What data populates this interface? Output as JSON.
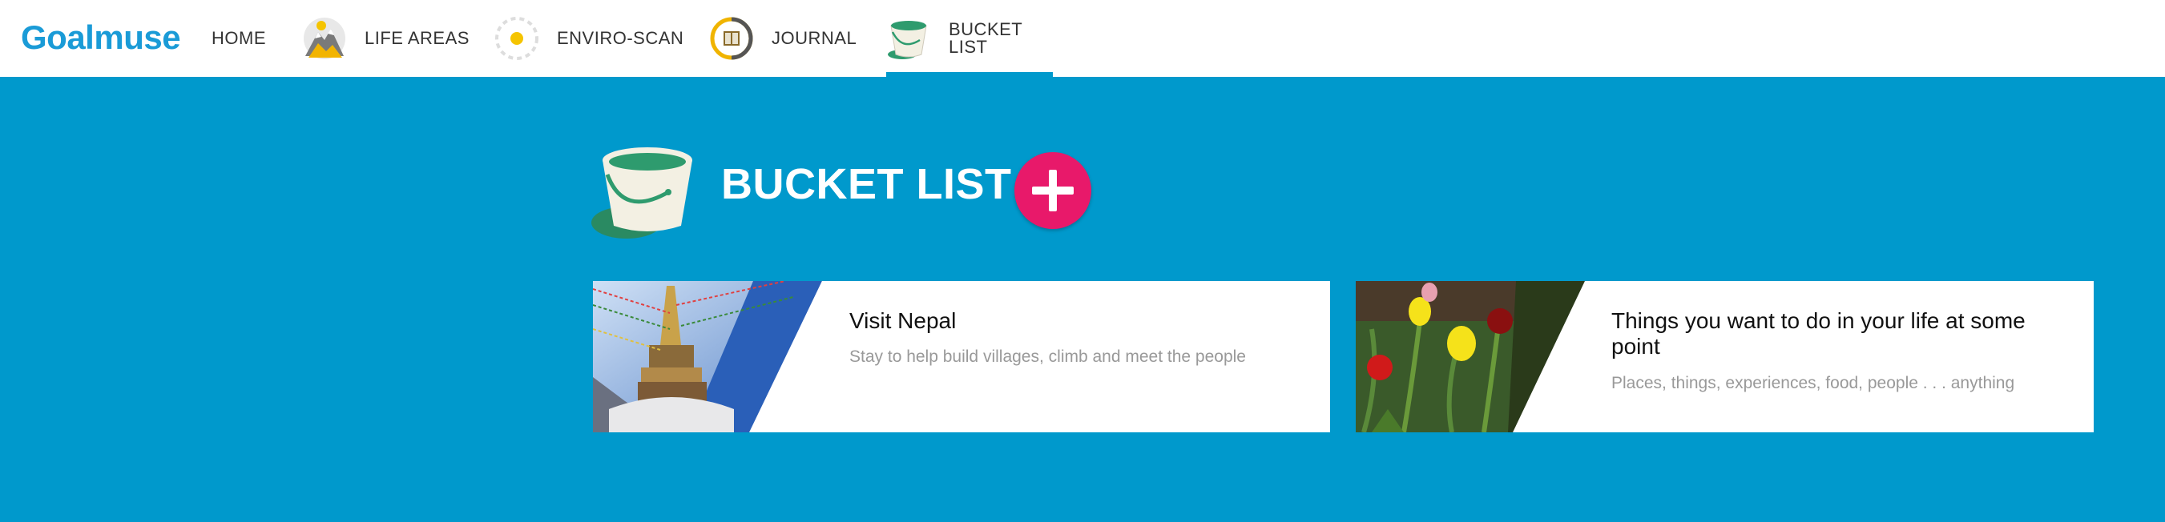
{
  "app": {
    "logo_text": "Goalmuse"
  },
  "nav": {
    "items": [
      {
        "label": "HOME",
        "icon": "none",
        "active": false
      },
      {
        "label": "LIFE AREAS",
        "icon": "mountain-icon",
        "active": false
      },
      {
        "label": "ENVIRO-SCAN",
        "icon": "sun-dotted-icon",
        "active": false
      },
      {
        "label": "JOURNAL",
        "icon": "journal-ring-icon",
        "active": false
      },
      {
        "label": "BUCKET LIST",
        "icon": "bucket-icon",
        "active": true
      }
    ]
  },
  "page": {
    "title": "BUCKET LIST",
    "header_icon": "bucket-icon",
    "add_button_icon": "plus-icon"
  },
  "cards": [
    {
      "title": "Visit Nepal",
      "description": "Stay to help build villages, climb and meet the people",
      "image": "stupa-photo"
    },
    {
      "title": "Things you want to do in your life at some point",
      "description": "Places, things, experiences, food, people . . . anything",
      "image": "tulips-photo"
    }
  ],
  "colors": {
    "background": "#0099cc",
    "nav_background": "#ffffff",
    "active_indicator": "#0099cc",
    "add_button": "#e8196a",
    "logo": "#1a9bd7",
    "bucket_green": "#2e9b6e",
    "bucket_cream": "#f3f0e3"
  }
}
